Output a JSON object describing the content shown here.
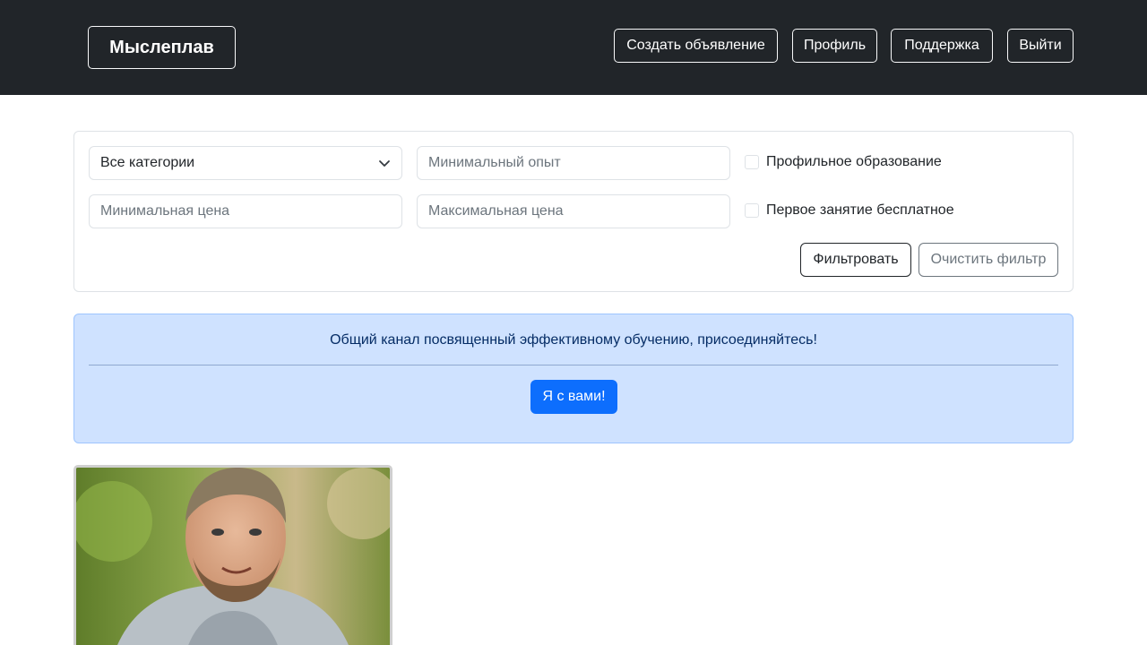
{
  "navbar": {
    "brand": "Мыслеплав",
    "buttons": {
      "create": "Создать объявление",
      "profile": "Профиль",
      "support": "Поддержка",
      "logout": "Выйти"
    }
  },
  "filter": {
    "category_select": {
      "value": "Все категории"
    },
    "min_experience": {
      "placeholder": "Минимальный опыт"
    },
    "min_price": {
      "placeholder": "Минимальная цена"
    },
    "max_price": {
      "placeholder": "Максимальная цена"
    },
    "checkbox_education": {
      "label": "Профильное образование",
      "checked": false
    },
    "checkbox_free_lesson": {
      "label": "Первое занятие бесплатное",
      "checked": false
    },
    "filter_button": "Фильтровать",
    "clear_button": "Очистить фильтр"
  },
  "banner": {
    "text": "Общий канал посвященный эффективному обучению, присоединяйтесь!",
    "join_button": "Я с вами!"
  },
  "colors": {
    "navbar_bg": "#212529",
    "primary": "#0d6efd",
    "alert_bg": "#cfe2ff",
    "alert_text": "#052c65"
  },
  "icons": {
    "select_arrow": "chevron-down-icon"
  }
}
